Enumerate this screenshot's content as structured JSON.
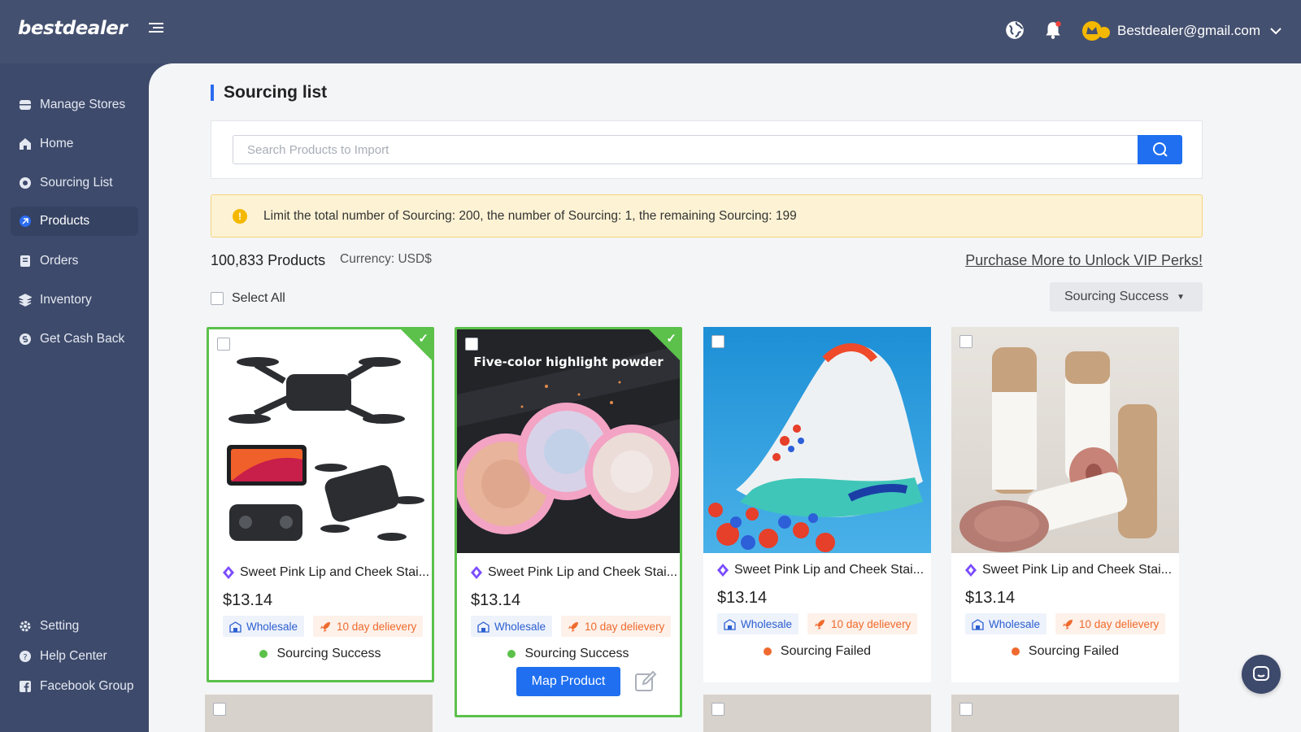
{
  "app": {
    "logo": "bestdealer"
  },
  "header": {
    "account_email": "Bestdealer@gmail.com"
  },
  "sidebar": {
    "items": [
      {
        "label": "Manage Stores",
        "icon": "store-icon"
      },
      {
        "label": "Home",
        "icon": "home-icon"
      },
      {
        "label": "Sourcing List",
        "icon": "sourcing-icon"
      },
      {
        "label": "Products",
        "icon": "products-icon",
        "active": true
      },
      {
        "label": "Orders",
        "icon": "orders-icon"
      },
      {
        "label": "Inventory",
        "icon": "inventory-icon"
      },
      {
        "label": "Get Cash Back",
        "icon": "cashback-icon"
      }
    ],
    "bottom_items": [
      {
        "label": "Setting",
        "icon": "gear-icon"
      },
      {
        "label": "Help Center",
        "icon": "help-icon"
      },
      {
        "label": "Facebook Group",
        "icon": "facebook-icon"
      }
    ]
  },
  "main": {
    "title": "Sourcing list",
    "search": {
      "placeholder": "Search Products to Import",
      "value": ""
    },
    "notice": "Limit the total number of Sourcing: 200, the number of Sourcing: 1, the remaining Sourcing: 199",
    "products_count": "100,833 Products",
    "currency": "Currency: USD$",
    "vip_link": "Purchase More to Unlock VIP Perks!",
    "select_all": "Select All",
    "filter": {
      "selected": "Sourcing Success"
    }
  },
  "products": [
    {
      "name": "Sweet Pink Lip and Cheek Stai...",
      "price": "$13.14",
      "tag_wholesale": "Wholesale",
      "tag_delivery": "10 day delievery",
      "status": "Sourcing Success",
      "status_type": "success",
      "selected": true,
      "image": "drone"
    },
    {
      "name": "Sweet Pink Lip and Cheek Stai...",
      "price": "$13.14",
      "tag_wholesale": "Wholesale",
      "tag_delivery": "10 day delievery",
      "status": "Sourcing Success",
      "status_type": "success",
      "selected": true,
      "image": "highlighter",
      "image_caption": "Five-color highlight powder",
      "action": "Map Product"
    },
    {
      "name": "Sweet Pink Lip and Cheek Stai...",
      "price": "$13.14",
      "tag_wholesale": "Wholesale",
      "tag_delivery": "10 day delievery",
      "status": "Sourcing Failed",
      "status_type": "failed",
      "selected": false,
      "image": "sneaker"
    },
    {
      "name": "Sweet Pink Lip and Cheek Stai...",
      "price": "$13.14",
      "tag_wholesale": "Wholesale",
      "tag_delivery": "10 day delievery",
      "status": "Sourcing Failed",
      "status_type": "failed",
      "selected": false,
      "image": "beauty-stick"
    }
  ],
  "colors": {
    "primary": "#1f6ff0",
    "success": "#5bc14a",
    "failed": "#f06a2f",
    "sidebar": "#3d4a6b"
  }
}
